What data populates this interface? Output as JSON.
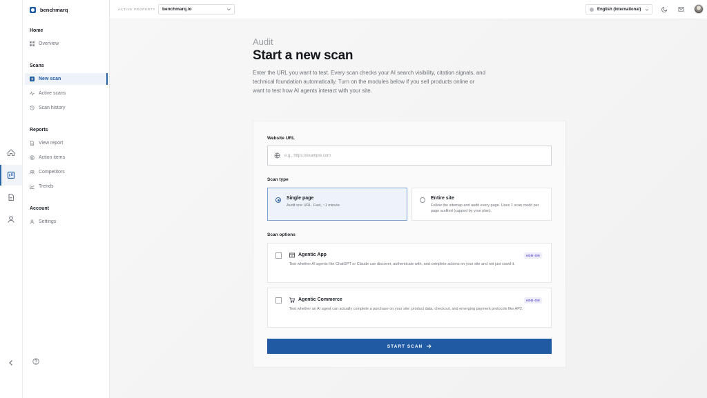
{
  "brand": {
    "name": "benchmarq"
  },
  "sidebar": {
    "sections": [
      {
        "title": "Home",
        "items": [
          {
            "label": "Overview",
            "icon": "grid-icon"
          }
        ]
      },
      {
        "title": "Scans",
        "items": [
          {
            "label": "New scan",
            "icon": "plus-square-icon",
            "active": true
          },
          {
            "label": "Active scans",
            "icon": "activity-icon"
          },
          {
            "label": "Scan history",
            "icon": "history-icon"
          }
        ]
      },
      {
        "title": "Reports",
        "items": [
          {
            "label": "View report",
            "icon": "document-icon"
          },
          {
            "label": "Action items",
            "icon": "target-icon"
          },
          {
            "label": "Competitors",
            "icon": "users-icon"
          },
          {
            "label": "Trends",
            "icon": "trend-chart-icon"
          }
        ]
      },
      {
        "title": "Account",
        "items": [
          {
            "label": "Settings",
            "icon": "user-icon"
          }
        ]
      }
    ]
  },
  "topbar": {
    "active_property_label": "ACTIVE PROPERTY",
    "property": "benchmarq.io",
    "language": "English (International)"
  },
  "page": {
    "eyebrow": "Audit",
    "title": "Start a new scan",
    "description": "Enter the URL you want to test. Every scan checks your AI search visibility, citation signals, and technical foundation automatically. Turn on the modules below if you sell products online or want to test how AI agents interact with your site."
  },
  "form": {
    "url_label": "Website URL",
    "url_placeholder": "e.g., https://example.com",
    "url_value": "",
    "scan_type_label": "Scan type",
    "scan_types": [
      {
        "title": "Single page",
        "desc": "Audit one URL. Fast, ~1 minute.",
        "selected": true
      },
      {
        "title": "Entire site",
        "desc": "Follow the sitemap and audit every page. Uses 1 scan credit per page audited (capped by your plan).",
        "selected": false
      }
    ],
    "scan_options_label": "Scan options",
    "modules": [
      {
        "title": "Agentic App",
        "badge": "ADD-ON",
        "icon": "app-icon",
        "desc": "Test whether AI agents like ChatGPT or Claude can discover, authenticate with, and complete actions on your site and not just crawl it."
      },
      {
        "title": "Agentic Commerce",
        "badge": "ADD-ON",
        "icon": "cart-icon",
        "desc": "Test whether an AI agent can actually complete a purchase on your site: product data, checkout, and emerging payment protocols like AP2."
      }
    ],
    "submit_label": "START SCAN"
  },
  "colors": {
    "accent": "#1f5aa3",
    "badge_text": "#5a4fd0"
  }
}
